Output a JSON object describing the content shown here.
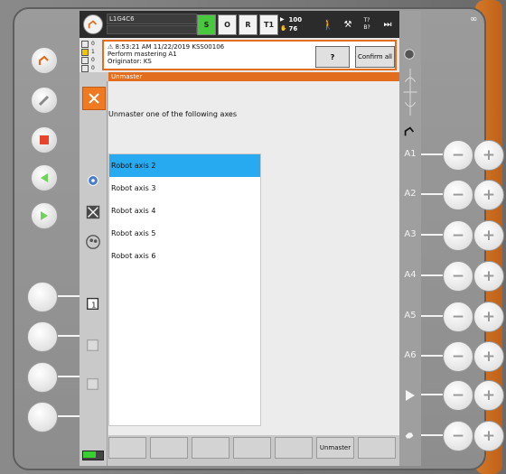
{
  "topbar": {
    "robot_name": "L1G4C6",
    "status_buttons": [
      "S",
      "O",
      "R",
      "T1"
    ],
    "override": "100",
    "override2": "76",
    "tool_label": "T?",
    "base_label": "B?",
    "infinity": "∞"
  },
  "messages": {
    "counters": [
      {
        "value": "0",
        "color": "#e8e8e8"
      },
      {
        "value": "1",
        "color": "#f3c400"
      },
      {
        "value": "0",
        "color": "#e8e8e8"
      },
      {
        "value": "0",
        "color": "#e8e8e8"
      }
    ],
    "line1": "8:53:21 AM 11/22/2019 KSS00106",
    "line2": "Perform mastering A1",
    "line3": "Originator: KS",
    "help_label": "?",
    "confirm_all_label": "Confirm all"
  },
  "window": {
    "title": "Unmaster",
    "prompt": "Unmaster one of the following axes"
  },
  "axes_list": {
    "items": [
      "Robot axis 2",
      "Robot axis 3",
      "Robot axis 4",
      "Robot axis 5",
      "Robot axis 6"
    ],
    "selected_index": 0
  },
  "bottombar": {
    "unmaster_label": "Unmaster"
  },
  "jog": {
    "axis_labels": [
      "A1",
      "A2",
      "A3",
      "A4",
      "A5",
      "A6"
    ],
    "minus": "−",
    "plus": "+"
  },
  "colors": {
    "accent": "#e26d1e",
    "selection": "#27aaf0",
    "status_green": "#48c83c"
  }
}
